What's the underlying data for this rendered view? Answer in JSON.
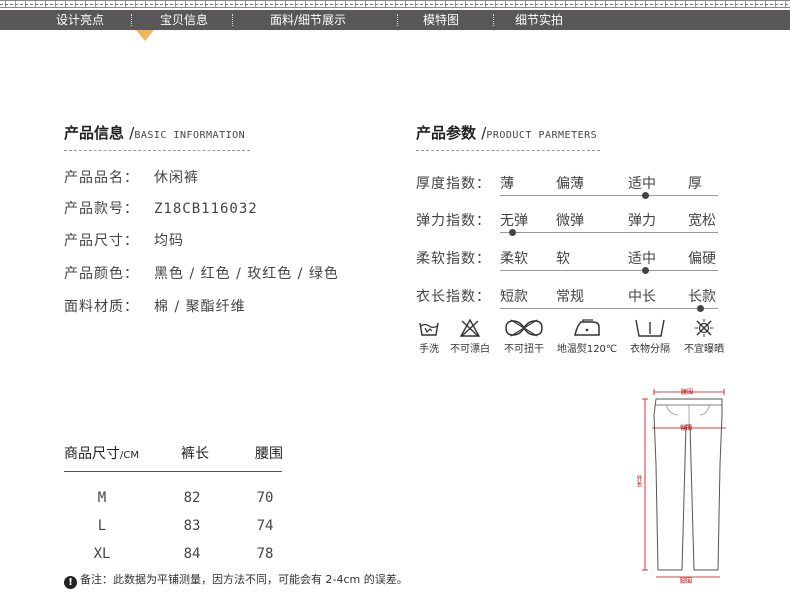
{
  "nav": {
    "items": [
      "设计亮点",
      "宝贝信息",
      "面料/细节展示",
      "模特图",
      "细节实拍"
    ]
  },
  "product_info": {
    "title": "产品信息",
    "subtitle": "BASIC INFORMATION",
    "rows": [
      {
        "label": "产品品名：",
        "value": "休闲裤"
      },
      {
        "label": "产品款号：",
        "value": "Z18CB116032"
      },
      {
        "label": "产品尺寸：",
        "value": "均码"
      },
      {
        "label": "产品颜色：",
        "value": "黑色 / 红色 / 玫红色 / 绿色"
      },
      {
        "label": "面料材质：",
        "value": "棉 / 聚酯纤维"
      }
    ]
  },
  "product_params": {
    "title": "产品参数",
    "subtitle": "PRODUCT PARMETERS",
    "rows": [
      {
        "label": "厚度指数：",
        "options": [
          "薄",
          "偏薄",
          "适中",
          "厚"
        ],
        "selected_index": 2
      },
      {
        "label": "弹力指数：",
        "options": [
          "无弹",
          "微弹",
          "弹力",
          "宽松"
        ],
        "selected_index": 0
      },
      {
        "label": "柔软指数：",
        "options": [
          "柔软",
          "软",
          "适中",
          "偏硬"
        ],
        "selected_index": 2
      },
      {
        "label": "衣长指数：",
        "options": [
          "短款",
          "常规",
          "中长",
          "长款"
        ],
        "selected_index": 3
      }
    ]
  },
  "care": [
    {
      "icon": "hand-wash-icon",
      "label": "手洗"
    },
    {
      "icon": "no-bleach-icon",
      "label": "不可漂白"
    },
    {
      "icon": "no-wring-icon",
      "label": "不可扭干"
    },
    {
      "icon": "iron-icon",
      "label": "地温熨120℃"
    },
    {
      "icon": "separate-wash-icon",
      "label": "衣物分隔"
    },
    {
      "icon": "no-sun-icon",
      "label": "不宜曝晒"
    }
  ],
  "size_table": {
    "headers": [
      "商品尺寸",
      "裤长",
      "腰围"
    ],
    "unit": "/CM",
    "rows": [
      [
        "M",
        "82",
        "70"
      ],
      [
        "L",
        "83",
        "74"
      ],
      [
        "XL",
        "84",
        "78"
      ]
    ]
  },
  "note": {
    "icon": "exclamation-icon",
    "text": "备注：此数据为平铺测量，因方法不同，可能会有 2-4cm 的误差。"
  },
  "diagram": {
    "labels": {
      "waist": "腰围",
      "hip": "臀围",
      "length": "外长",
      "hem": "脚围"
    }
  },
  "colors": {
    "nav_bg": "#595757",
    "pointer": "#f2b35a",
    "measure": "#c00000"
  }
}
